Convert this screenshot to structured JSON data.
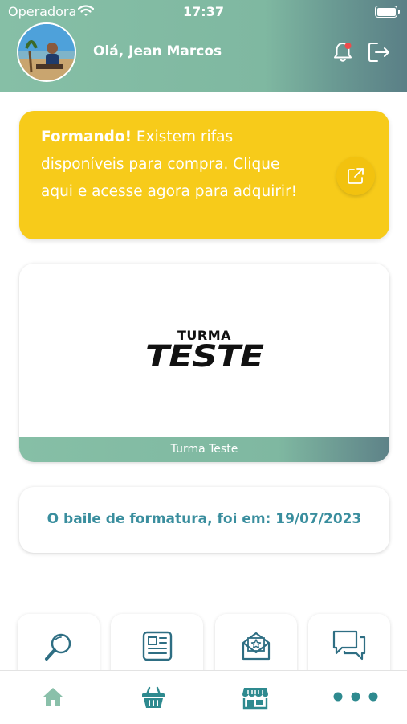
{
  "status_bar": {
    "carrier": "Operadora",
    "time": "17:37"
  },
  "header": {
    "greeting": "Olá, Jean Marcos"
  },
  "raffle_banner": {
    "bold_text": "Formando!",
    "text": " Existem rifas disponíveis para compra. Clique aqui e acesse agora para adquirir!"
  },
  "class_card": {
    "logo_small": "TURMA",
    "logo_big": "TESTE",
    "caption": "Turma Teste"
  },
  "prom_card": {
    "text": "O baile de formatura, foi em: 19/07/2023"
  },
  "colors": {
    "accent": "#86bfa6",
    "banner": "#f7cb1a",
    "prom_text": "#3a8e9e",
    "icon": "#2e6e83"
  },
  "quick_actions": [
    {
      "icon": "search-icon"
    },
    {
      "icon": "newspaper-icon"
    },
    {
      "icon": "envelope-star-icon"
    },
    {
      "icon": "chat-bubbles-icon"
    }
  ],
  "tabbar": [
    {
      "icon": "home-icon"
    },
    {
      "icon": "basket-icon"
    },
    {
      "icon": "store-icon"
    },
    {
      "icon": "more-dots-icon"
    }
  ]
}
